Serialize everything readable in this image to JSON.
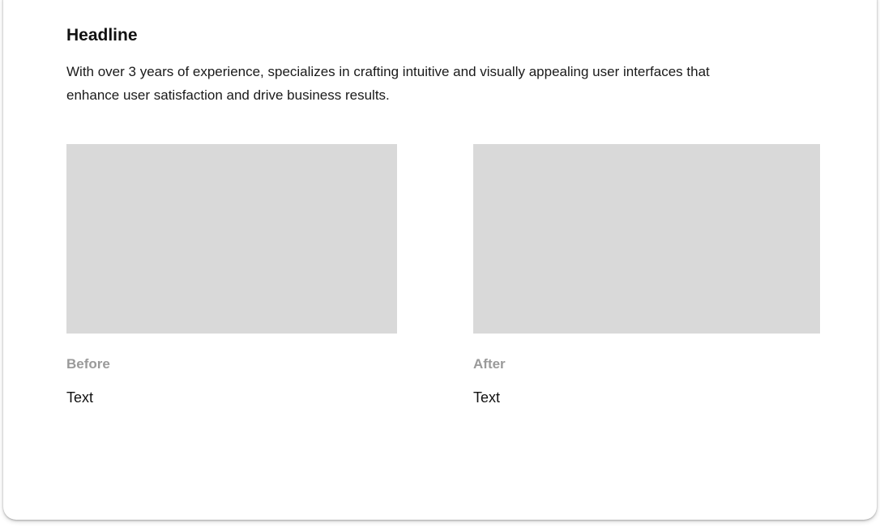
{
  "section": {
    "headline": "Headline",
    "description": "With over 3 years of experience, specializes in crafting intuitive and visually appealing user interfaces that enhance user satisfaction and drive business results."
  },
  "comparison": {
    "before": {
      "label": "Before",
      "text": "Text"
    },
    "after": {
      "label": "After",
      "text": "Text"
    }
  },
  "colors": {
    "placeholder": "#d9d9d9",
    "label": "#9a9a9a",
    "text": "#111111",
    "background": "#ffffff"
  }
}
